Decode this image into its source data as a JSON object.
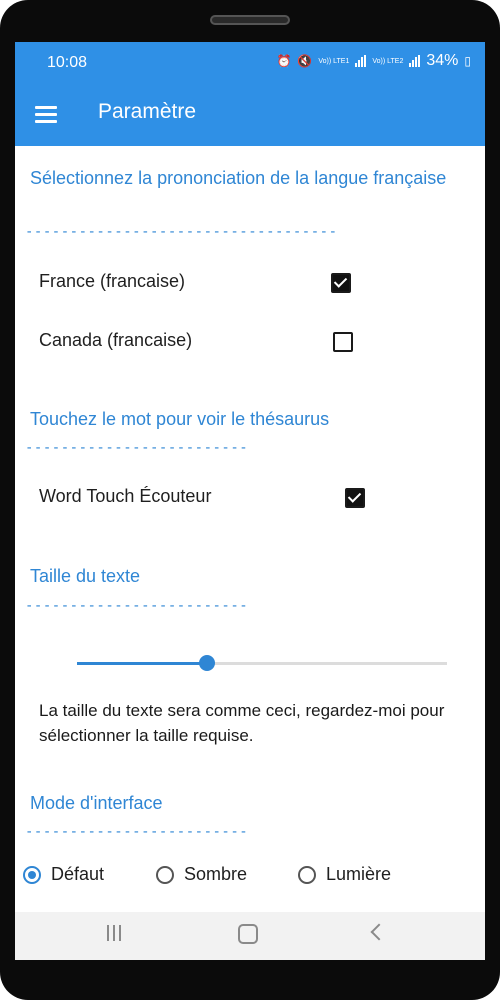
{
  "status_bar": {
    "time": "10:08",
    "battery": "34%",
    "sim1": "Vo)) LTE1",
    "sim2": "Vo)) LTE2"
  },
  "app_bar": {
    "title": "Paramètre",
    "menu_icon": "hamburger-menu-icon"
  },
  "sections": {
    "pronunciation": {
      "title": "Sélectionnez la prononciation de la langue française",
      "underline": "-----------------------------------",
      "options": [
        {
          "label": "France (francaise)",
          "checked": true
        },
        {
          "label": "Canada (francaise)",
          "checked": false
        }
      ]
    },
    "thesaurus": {
      "title": "Touchez le mot pour voir le thésaurus",
      "underline": "-------------------------",
      "options": [
        {
          "label": "Word Touch Écouteur",
          "checked": true
        }
      ]
    },
    "text_size": {
      "title": "Taille du texte",
      "underline": "-------------------------",
      "slider_value": 0.35,
      "preview": "La taille du texte sera comme ceci, regardez-moi pour sélectionner la taille requise."
    },
    "interface_mode": {
      "title": "Mode d'interface",
      "underline": "-------------------------",
      "options": [
        {
          "label": "Défaut",
          "selected": true
        },
        {
          "label": "Sombre",
          "selected": false
        },
        {
          "label": "Lumière",
          "selected": false
        }
      ]
    }
  },
  "nav_bar": {
    "icons": [
      "recents-icon",
      "home-icon",
      "back-icon"
    ]
  },
  "colors": {
    "accent": "#2f86d4",
    "app_bar": "#2f90e6"
  }
}
